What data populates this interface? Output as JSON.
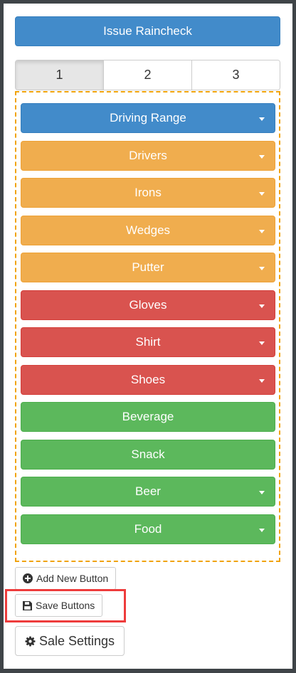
{
  "issue_raincheck_label": "Issue Raincheck",
  "tabs": [
    {
      "label": "1",
      "active": true
    },
    {
      "label": "2",
      "active": false
    },
    {
      "label": "3",
      "active": false
    }
  ],
  "buttons": [
    {
      "label": "Driving Range",
      "color": "blue",
      "dropdown": true
    },
    {
      "label": "Drivers",
      "color": "orange",
      "dropdown": true
    },
    {
      "label": "Irons",
      "color": "orange",
      "dropdown": true
    },
    {
      "label": "Wedges",
      "color": "orange",
      "dropdown": true
    },
    {
      "label": "Putter",
      "color": "orange",
      "dropdown": true
    },
    {
      "label": "Gloves",
      "color": "red",
      "dropdown": true
    },
    {
      "label": "Shirt",
      "color": "red",
      "dropdown": true
    },
    {
      "label": "Shoes",
      "color": "red",
      "dropdown": true
    },
    {
      "label": "Beverage",
      "color": "green",
      "dropdown": false
    },
    {
      "label": "Snack",
      "color": "green",
      "dropdown": false
    },
    {
      "label": "Beer",
      "color": "green",
      "dropdown": true
    },
    {
      "label": "Food",
      "color": "green",
      "dropdown": true
    }
  ],
  "actions": {
    "add_new_label": "Add New Button",
    "add_new_icon": "plus-circle-icon",
    "save_label": "Save Buttons",
    "save_icon": "floppy-disk-icon",
    "settings_label": "Sale Settings",
    "settings_icon": "gear-icon"
  },
  "colors": {
    "blue": "#428bca",
    "orange": "#f0ad4e",
    "red": "#d9534f",
    "green": "#5cb85c",
    "dropzone_border": "#f0a30a",
    "highlight": "#ee3c3c"
  }
}
